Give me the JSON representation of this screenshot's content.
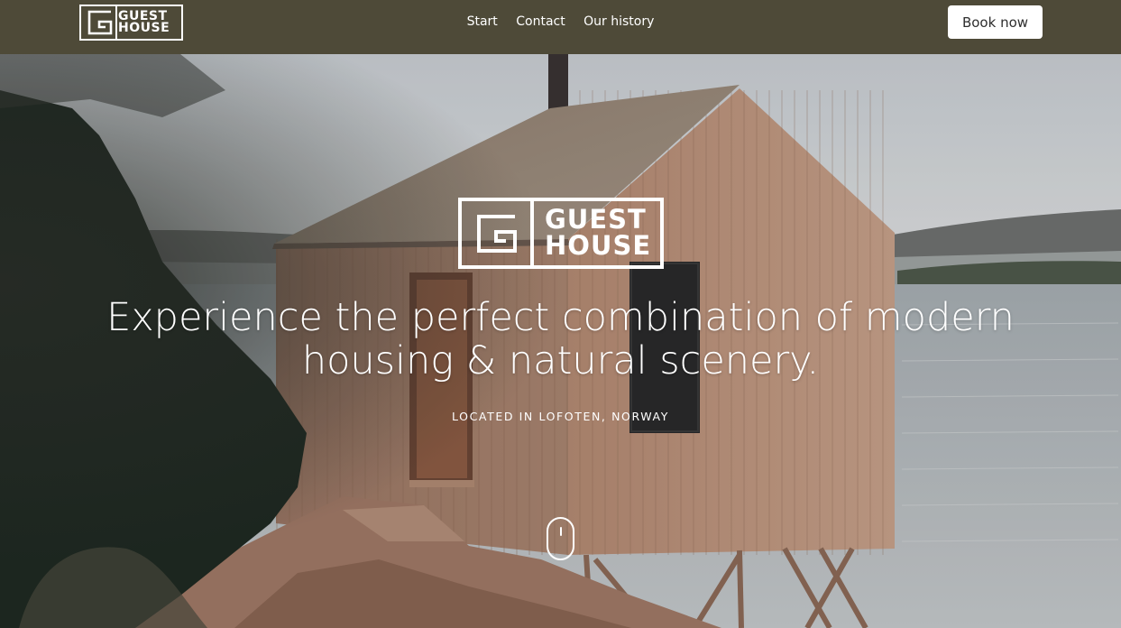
{
  "header": {
    "logo": {
      "line1": "GUEST",
      "line2": "HOUSE"
    },
    "nav": [
      {
        "label": "Start"
      },
      {
        "label": "Contact"
      },
      {
        "label": "Our history"
      }
    ],
    "book_button": "Book now"
  },
  "hero": {
    "logo": {
      "line1": "GUEST",
      "line2": "HOUSE"
    },
    "headline_line1": "Experience the perfect combination of modern",
    "headline_line2": "housing & natural scenery.",
    "location": "LOCATED IN LOFOTEN, NORWAY"
  },
  "colors": {
    "header_bg": "#4e4a38",
    "button_bg": "#ffffff",
    "button_text": "#2e2e2e",
    "text": "#ffffff"
  },
  "icons": [
    "g-logo-icon",
    "scroll-mouse-icon"
  ]
}
